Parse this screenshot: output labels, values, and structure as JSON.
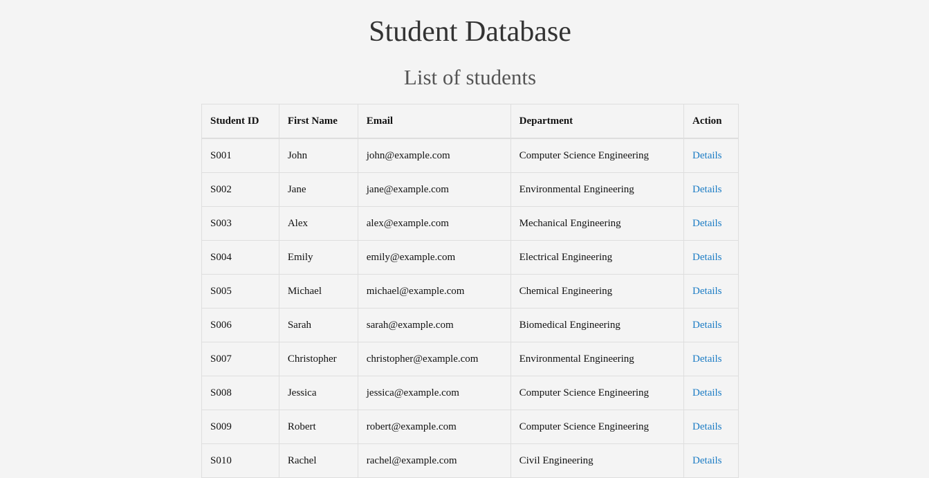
{
  "page": {
    "title": "Student Database",
    "subtitle": "List of students"
  },
  "table": {
    "headers": {
      "student_id": "Student ID",
      "first_name": "First Name",
      "email": "Email",
      "department": "Department",
      "action": "Action"
    },
    "rows": [
      {
        "id": "S001",
        "first_name": "John",
        "email": "john@example.com",
        "department": "Computer Science Engineering",
        "action": "Details"
      },
      {
        "id": "S002",
        "first_name": "Jane",
        "email": "jane@example.com",
        "department": "Environmental Engineering",
        "action": "Details"
      },
      {
        "id": "S003",
        "first_name": "Alex",
        "email": "alex@example.com",
        "department": "Mechanical Engineering",
        "action": "Details"
      },
      {
        "id": "S004",
        "first_name": "Emily",
        "email": "emily@example.com",
        "department": "Electrical Engineering",
        "action": "Details"
      },
      {
        "id": "S005",
        "first_name": "Michael",
        "email": "michael@example.com",
        "department": "Chemical Engineering",
        "action": "Details"
      },
      {
        "id": "S006",
        "first_name": "Sarah",
        "email": "sarah@example.com",
        "department": "Biomedical Engineering",
        "action": "Details"
      },
      {
        "id": "S007",
        "first_name": "Christopher",
        "email": "christopher@example.com",
        "department": "Environmental Engineering",
        "action": "Details"
      },
      {
        "id": "S008",
        "first_name": "Jessica",
        "email": "jessica@example.com",
        "department": "Computer Science Engineering",
        "action": "Details"
      },
      {
        "id": "S009",
        "first_name": "Robert",
        "email": "robert@example.com",
        "department": "Computer Science Engineering",
        "action": "Details"
      },
      {
        "id": "S010",
        "first_name": "Rachel",
        "email": "rachel@example.com",
        "department": "Civil Engineering",
        "action": "Details"
      }
    ]
  },
  "colors": {
    "background": "#f4f4f4",
    "link": "#1a7bc4",
    "border": "#dedede"
  }
}
